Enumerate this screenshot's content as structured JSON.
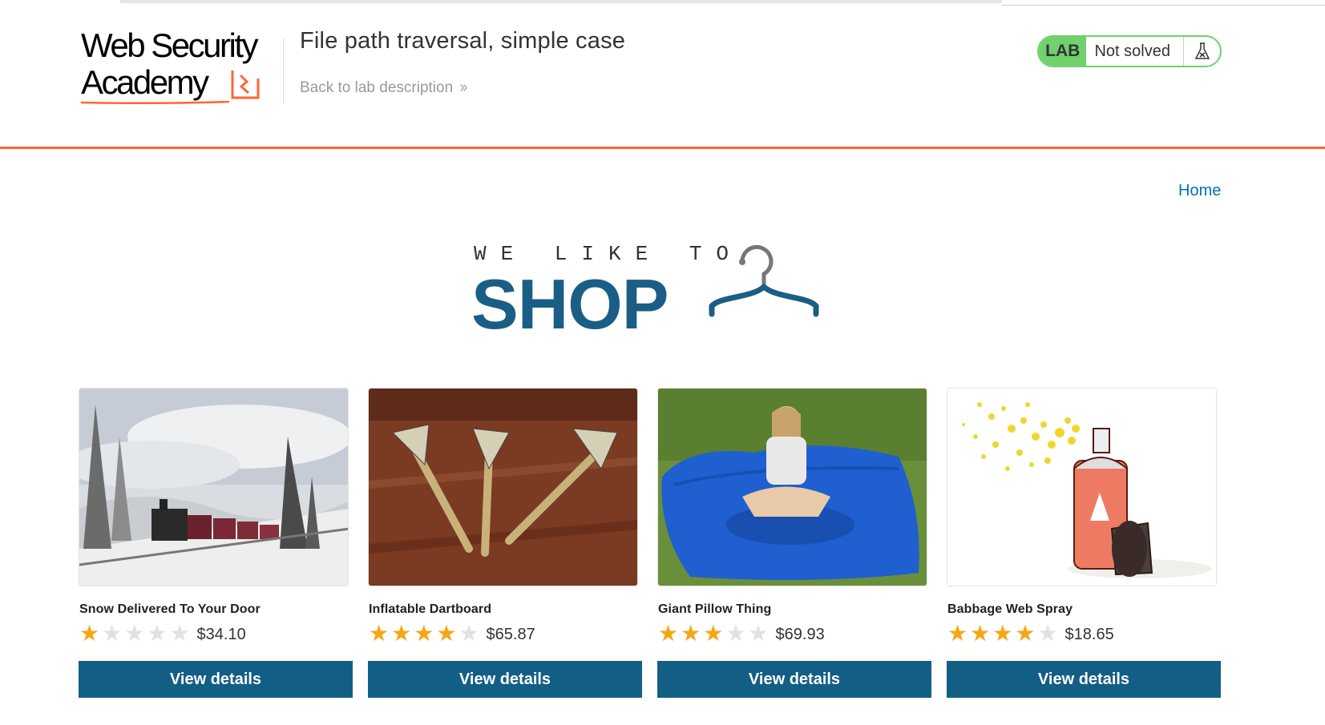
{
  "header": {
    "logo_line1": "Web Security",
    "logo_line2": "Academy",
    "lab_title": "File path traversal, simple case",
    "back_link": "Back to lab description",
    "status_tag": "LAB",
    "status_text": "Not solved"
  },
  "nav": {
    "home": "Home"
  },
  "banner": {
    "tagline": "WE LIKE TO",
    "shop": "SHOP"
  },
  "colors": {
    "accent": "#ff6633",
    "button": "#135e85",
    "star": "#f7a613",
    "lab_green": "#70d16d",
    "link": "#0071bc"
  },
  "products": [
    {
      "name": "Snow Delivered To Your Door",
      "rating": 1,
      "max_rating": 5,
      "price": "$34.10",
      "button": "View details"
    },
    {
      "name": "Inflatable Dartboard",
      "rating": 4,
      "max_rating": 5,
      "price": "$65.87",
      "button": "View details"
    },
    {
      "name": "Giant Pillow Thing",
      "rating": 3,
      "max_rating": 5,
      "price": "$69.93",
      "button": "View details"
    },
    {
      "name": "Babbage Web Spray",
      "rating": 4,
      "max_rating": 5,
      "price": "$18.65",
      "button": "View details"
    }
  ]
}
